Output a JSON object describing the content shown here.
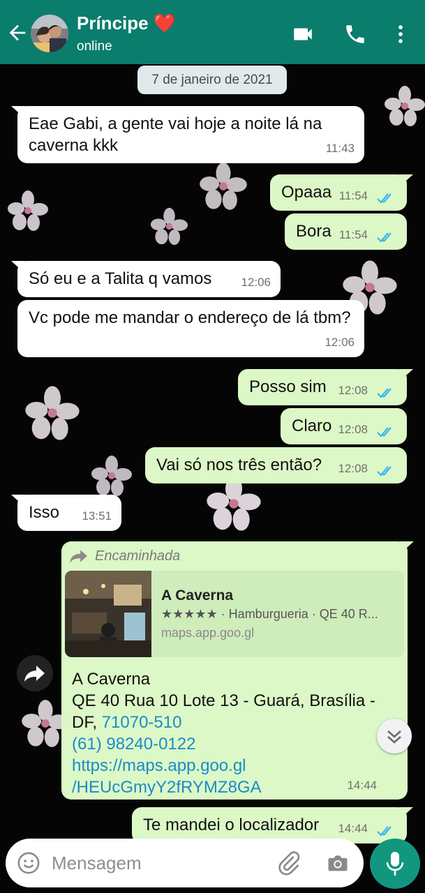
{
  "header": {
    "contact_name": "Príncipe ❤️",
    "status": "online",
    "accent_color": "#0a7d6d",
    "icons": [
      "back-arrow-icon",
      "video-call-icon",
      "voice-call-icon",
      "more-vert-icon"
    ]
  },
  "chat": {
    "date": "7 de janeiro de 2021",
    "messages": [
      {
        "dir": "in",
        "text": "Eae Gabi, a gente vai hoje a noite lá na caverna kkk",
        "time": "11:43"
      },
      {
        "dir": "out",
        "text": "Opaaa",
        "time": "11:54",
        "read": true
      },
      {
        "dir": "out",
        "text": "Bora",
        "time": "11:54",
        "read": true
      },
      {
        "dir": "in",
        "text": "Só eu e a Talita q vamos",
        "time": "12:06"
      },
      {
        "dir": "in",
        "text": "Vc pode me mandar o endereço de lá tbm?",
        "time": "12:06"
      },
      {
        "dir": "out",
        "text": "Posso sim",
        "time": "12:08",
        "read": true
      },
      {
        "dir": "out",
        "text": "Claro",
        "time": "12:08",
        "read": true
      },
      {
        "dir": "out",
        "text": "Vai só nos três então?",
        "time": "12:08",
        "read": true
      },
      {
        "dir": "in",
        "text": "Isso",
        "time": "13:51"
      }
    ],
    "forwarded": {
      "label": "Encaminhada",
      "preview_title": "A Caverna",
      "preview_desc": "★★★★★ · Hamburgueria · QE 40 R...",
      "preview_domain": "maps.app.goo.gl",
      "line1": "A Caverna",
      "line2": "QE 40 Rua 10 Lote 13 - Guará, Brasília -",
      "line3_prefix": "DF, ",
      "cep": "71070-510",
      "phone": "(61) 98240-0122",
      "url_line1": "https://maps.app.goo.gl",
      "url_line2": "/HEUcGmyY2fRYMZ8GA",
      "time": "14:44"
    },
    "last_message": {
      "dir": "out",
      "text": "Te mandei o localizador",
      "time": "14:44",
      "read": true
    }
  },
  "input": {
    "placeholder": "Mensagem",
    "icons": [
      "emoji-icon",
      "attach-icon",
      "camera-icon",
      "mic-icon"
    ]
  },
  "colors": {
    "incoming_bubble": "#ffffff",
    "outgoing_bubble": "#dcf8c6",
    "read_ticks": "#34b7f1",
    "link": "#1b8bc9"
  }
}
